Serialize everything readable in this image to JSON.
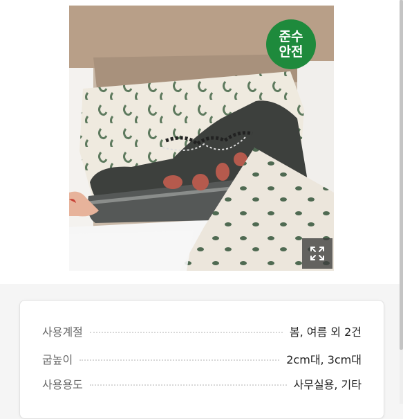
{
  "product_image": {
    "badge_lines": [
      "준수",
      "안전"
    ],
    "badge_color": "#1e8a3c",
    "expand_icon": "expand-icon"
  },
  "info": {
    "rows": [
      {
        "label": "사용계절",
        "value": "봄, 여름 외 2건"
      },
      {
        "label": "굽높이",
        "value": "2cm대, 3cm대"
      },
      {
        "label": "사용용도",
        "value": "사무실용, 기타"
      }
    ]
  }
}
